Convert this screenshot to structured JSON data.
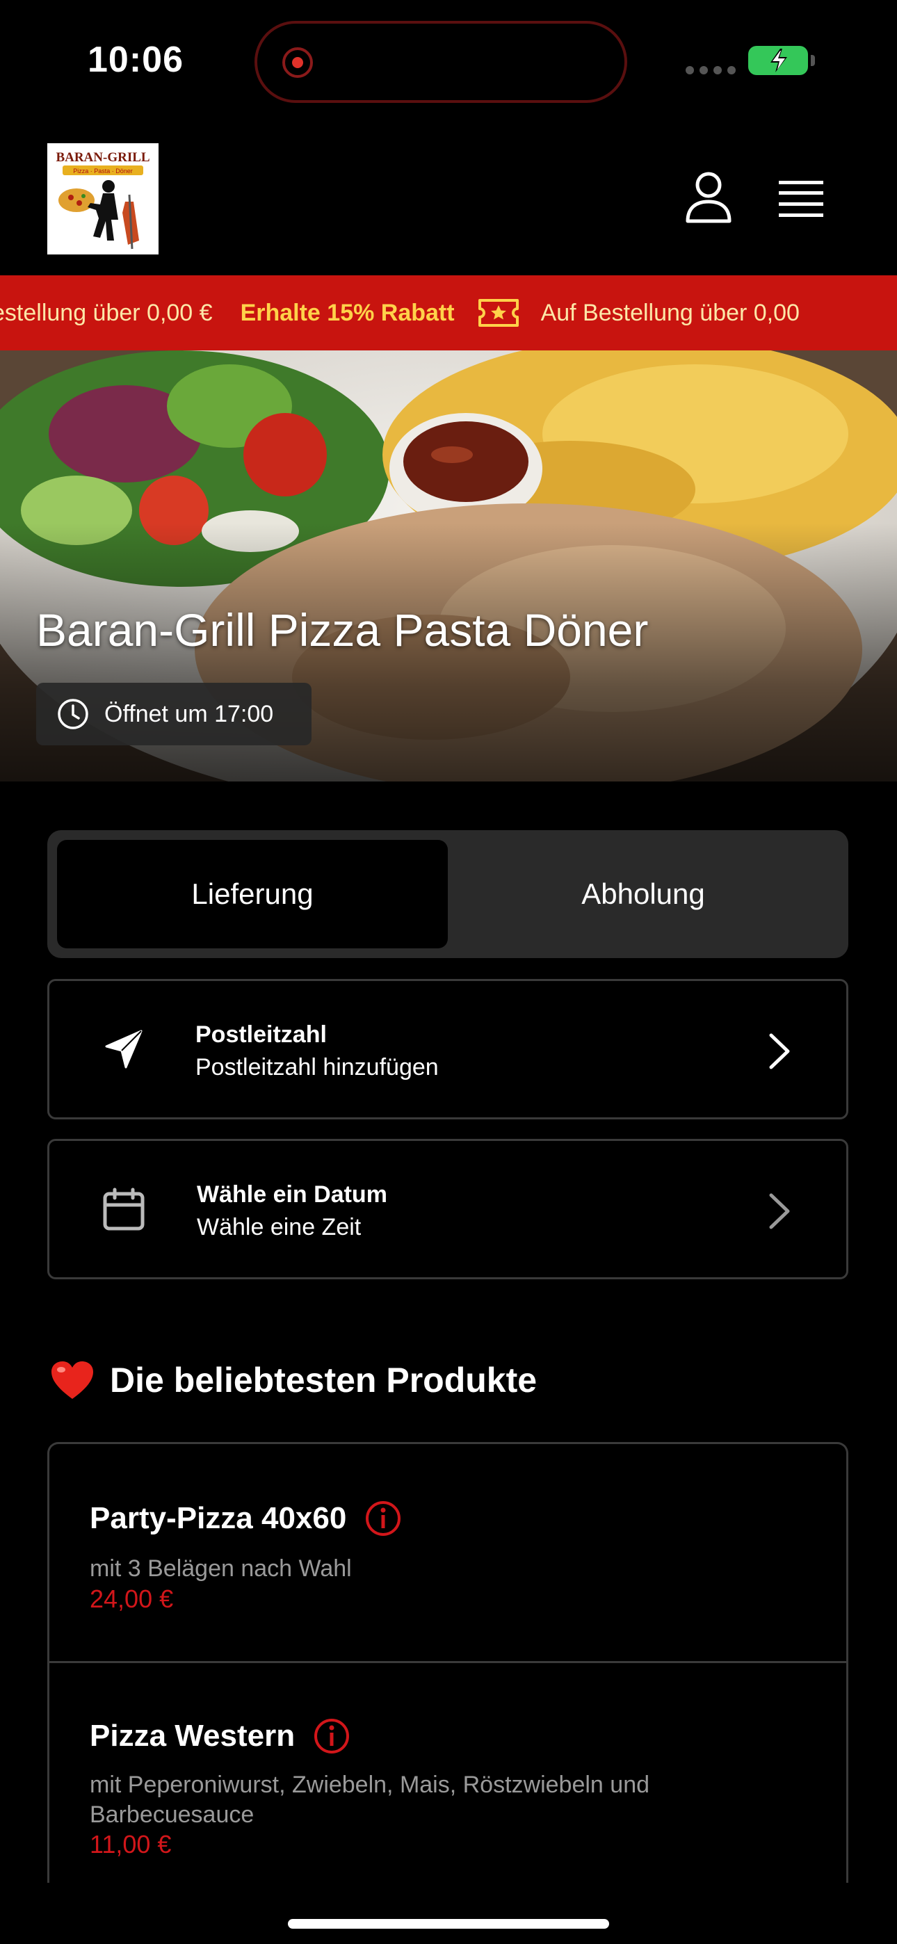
{
  "status_bar": {
    "time": "10:06"
  },
  "header": {
    "logo_text": "BARAN-GRILL",
    "logo_subtext": "Pizza · Pasta · Döner"
  },
  "promo": {
    "leading_text": "estellung über 0,00 €",
    "discount_text": "Erhalte 15% Rabatt",
    "trailing_text": "Auf Bestellung über 0,00",
    "accent_color": "#c8140f"
  },
  "hero": {
    "restaurant_name": "Baran-Grill Pizza Pasta Döner",
    "open_status": "Öffnet um 17:00"
  },
  "order_type": {
    "options": [
      "Lieferung",
      "Abholung"
    ],
    "selected": "Lieferung"
  },
  "postcode": {
    "label": "Postleitzahl",
    "value": "Postleitzahl hinzufügen"
  },
  "schedule": {
    "label": "Wähle ein Datum",
    "value": "Wähle eine Zeit"
  },
  "popular": {
    "title": "Die beliebtesten Produkte",
    "products": [
      {
        "name": "Party-Pizza 40x60",
        "description": "mit 3 Belägen nach Wahl",
        "price": "24,00 €"
      },
      {
        "name": "Pizza Western",
        "description": "mit Peperoniwurst, Zwiebeln, Mais, Röstzwiebeln und Barbecuesauce",
        "price": "11,00 €"
      }
    ]
  },
  "icons": {
    "user": "user-icon",
    "menu": "hamburger-menu-icon",
    "clock": "clock-icon",
    "location": "location-arrow-icon",
    "calendar": "calendar-icon",
    "chevron": "chevron-right-icon",
    "info": "info-icon",
    "heart": "heart-icon",
    "coupon": "coupon-icon"
  },
  "colors": {
    "background": "#000000",
    "price": "#d2161a",
    "info": "#d2161a",
    "promo_text": "#ffd24a"
  }
}
